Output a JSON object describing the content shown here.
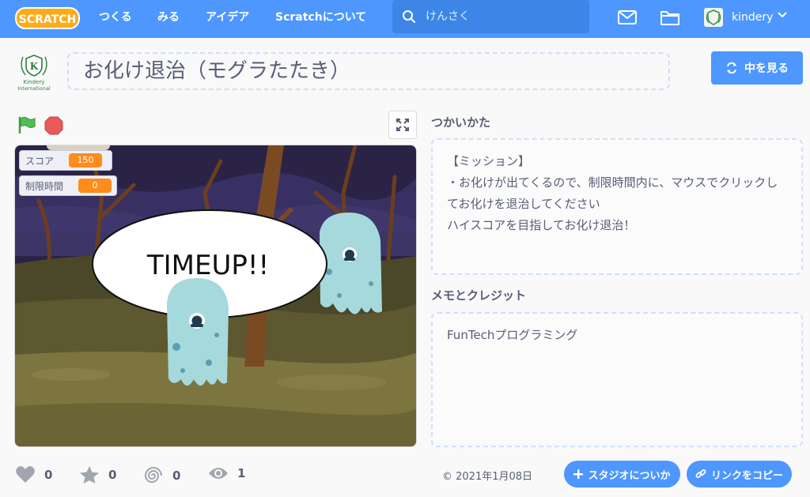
{
  "nav": {
    "logo_text": "SCRATCH",
    "links": [
      "つくる",
      "みる",
      "アイデア",
      "Scratchについて"
    ],
    "search_placeholder": "けんさく",
    "username": "kindery"
  },
  "project": {
    "title": "お化け退治（モグラたたき）",
    "see_inside_label": "中を見る",
    "avatar_text_1": "Kindery",
    "avatar_text_2": "International"
  },
  "stage": {
    "monitors": [
      {
        "label": "スコア",
        "value": "150"
      },
      {
        "label": "制限時間",
        "value": "0"
      }
    ],
    "speech": "TIMEUP!!"
  },
  "instructions": {
    "heading": "つかいかた",
    "text": "【ミッション】\n・お化けが出てくるので、制限時間内に、マウスでクリックしてお化けを退治してください\nハイスコアを目指してお化け退治！"
  },
  "credits": {
    "heading": "メモとクレジット",
    "text": "FunTechプログラミング"
  },
  "stats": {
    "loves": "0",
    "favorites": "0",
    "remixes": "0",
    "views": "1"
  },
  "footer": {
    "date": "2021年1月08日",
    "add_to_studio_label": "スタジオについか",
    "copy_link_label": "リンクをコピー"
  },
  "colors": {
    "nav_blue": "#4d97ff",
    "monitor_orange": "#ff8c1a",
    "flag_green": "#4cbf56",
    "stop_red": "#ec5959"
  }
}
